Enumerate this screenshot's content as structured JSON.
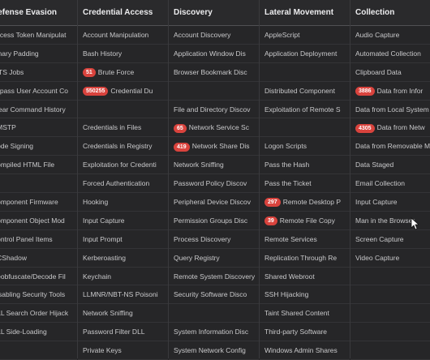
{
  "columns": [
    {
      "title": "Defense Evasion",
      "items": [
        {
          "label": "Access Token Manipulat"
        },
        {
          "label": "Binary Padding"
        },
        {
          "label": "BITS Jobs"
        },
        {
          "label": "Bypass User Account Co"
        },
        {
          "label": "Clear Command History"
        },
        {
          "label": "CMSTP"
        },
        {
          "label": "Code Signing"
        },
        {
          "label": "Compiled HTML File"
        },
        {
          "label": ""
        },
        {
          "label": "Component Firmware"
        },
        {
          "label": "Component Object Mod"
        },
        {
          "label": "Control Panel Items"
        },
        {
          "label": "DCShadow"
        },
        {
          "label": "Deobfuscate/Decode Fil"
        },
        {
          "label": "Disabling Security Tools"
        },
        {
          "label": "DLL Search Order Hijack"
        },
        {
          "label": "DLL Side-Loading"
        },
        {
          "label": ""
        }
      ]
    },
    {
      "title": "Credential Access",
      "items": [
        {
          "label": "Account Manipulation"
        },
        {
          "label": "Bash History"
        },
        {
          "badge": "51",
          "label": "Brute Force"
        },
        {
          "badge": "550255",
          "label": "Credential Du"
        },
        {
          "label": ""
        },
        {
          "label": "Credentials in Files"
        },
        {
          "label": "Credentials in Registry"
        },
        {
          "label": "Exploitation for Credenti"
        },
        {
          "label": "Forced Authentication"
        },
        {
          "label": "Hooking"
        },
        {
          "label": "Input Capture"
        },
        {
          "label": "Input Prompt"
        },
        {
          "label": "Kerberoasting"
        },
        {
          "label": "Keychain"
        },
        {
          "label": "LLMNR/NBT-NS Poisoni"
        },
        {
          "label": "Network Sniffing"
        },
        {
          "label": "Password Filter DLL"
        },
        {
          "label": "Private Keys"
        }
      ]
    },
    {
      "title": "Discovery",
      "items": [
        {
          "label": "Account Discovery"
        },
        {
          "label": "Application Window Dis"
        },
        {
          "label": "Browser Bookmark Disc"
        },
        {
          "label": ""
        },
        {
          "label": "File and Directory Discov"
        },
        {
          "badge": "65",
          "label": "Network Service Sc"
        },
        {
          "badge": "419",
          "label": "Network Share Dis"
        },
        {
          "label": "Network Sniffing"
        },
        {
          "label": "Password Policy Discov"
        },
        {
          "label": "Peripheral Device Discov"
        },
        {
          "label": "Permission Groups Disc"
        },
        {
          "label": "Process Discovery"
        },
        {
          "label": "Query Registry"
        },
        {
          "label": "Remote System Discovery"
        },
        {
          "label": "Security Software Disco"
        },
        {
          "label": ""
        },
        {
          "label": "System Information Disc"
        },
        {
          "label": "System Network Config"
        }
      ]
    },
    {
      "title": "Lateral Movement",
      "items": [
        {
          "label": "AppleScript"
        },
        {
          "label": "Application Deployment"
        },
        {
          "label": ""
        },
        {
          "label": "Distributed Component"
        },
        {
          "label": "Exploitation of Remote S"
        },
        {
          "label": ""
        },
        {
          "label": "Logon Scripts"
        },
        {
          "label": "Pass the Hash"
        },
        {
          "label": "Pass the Ticket"
        },
        {
          "badge": "297",
          "label": "Remote Desktop P"
        },
        {
          "badge": "39",
          "label": "Remote File Copy"
        },
        {
          "label": "Remote Services"
        },
        {
          "label": "Replication Through Re"
        },
        {
          "label": "Shared Webroot"
        },
        {
          "label": "SSH Hijacking"
        },
        {
          "label": "Taint Shared Content"
        },
        {
          "label": "Third-party Software"
        },
        {
          "label": "Windows Admin Shares"
        }
      ]
    },
    {
      "title": "Collection",
      "items": [
        {
          "label": "Audio Capture"
        },
        {
          "label": "Automated Collection"
        },
        {
          "label": "Clipboard Data"
        },
        {
          "badge": "3886",
          "label": "Data from Infor"
        },
        {
          "label": "Data from Local System"
        },
        {
          "badge": "4305",
          "label": "Data from Netw"
        },
        {
          "label": "Data from Removable M"
        },
        {
          "label": "Data Staged"
        },
        {
          "label": "Email Collection"
        },
        {
          "label": "Input Capture"
        },
        {
          "label": "Man in the Browser"
        },
        {
          "label": "Screen Capture"
        },
        {
          "label": "Video Capture"
        },
        {
          "label": ""
        },
        {
          "label": ""
        },
        {
          "label": ""
        },
        {
          "label": ""
        },
        {
          "label": ""
        }
      ]
    }
  ]
}
